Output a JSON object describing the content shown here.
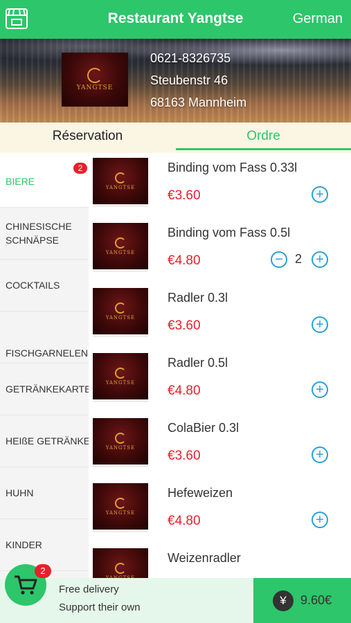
{
  "header": {
    "title": "Restaurant Yangtse",
    "language": "German",
    "icon": "store-icon"
  },
  "restaurant": {
    "logo_text": "YANGTSE",
    "phone": "0621-8326735",
    "street": "Steubenstr 46",
    "city": "68163 Mannheim"
  },
  "tabs": [
    {
      "label": "Réservation",
      "active": false
    },
    {
      "label": "Ordre",
      "active": true
    }
  ],
  "categories": [
    {
      "label": "BIERE",
      "active": true,
      "badge": "2"
    },
    {
      "label": "CHINESISCHE SCHNÄPSE"
    },
    {
      "label": "COCKTAILS"
    },
    {
      "label": "FISCHGARNELEN"
    },
    {
      "label": "GETRÄNKEKARTE"
    },
    {
      "label": "HEIßE GETRÄNKE"
    },
    {
      "label": "HUHN"
    },
    {
      "label": "KINDER"
    }
  ],
  "products": [
    {
      "name": "Binding vom Fass 0.33l",
      "price": "€3.60"
    },
    {
      "name": "Binding vom Fass 0.5l",
      "price": "€4.80",
      "quantity": "2"
    },
    {
      "name": "Radler 0.3l",
      "price": "€3.60"
    },
    {
      "name": "Radler 0.5l",
      "price": "€4.80"
    },
    {
      "name": "ColaBier 0.3l",
      "price": "€3.60"
    },
    {
      "name": "Hefeweizen",
      "price": "€4.80"
    },
    {
      "name": "Weizenradler",
      "price": ""
    }
  ],
  "cart": {
    "badge": "2",
    "line1": "Free delivery",
    "line2": "Support their own",
    "currency_symbol": "¥",
    "total": "9.60€"
  },
  "colors": {
    "brand": "#2dc66a",
    "price": "#e8202a",
    "stepper": "#2a9fd8",
    "badge": "#e8202a"
  }
}
